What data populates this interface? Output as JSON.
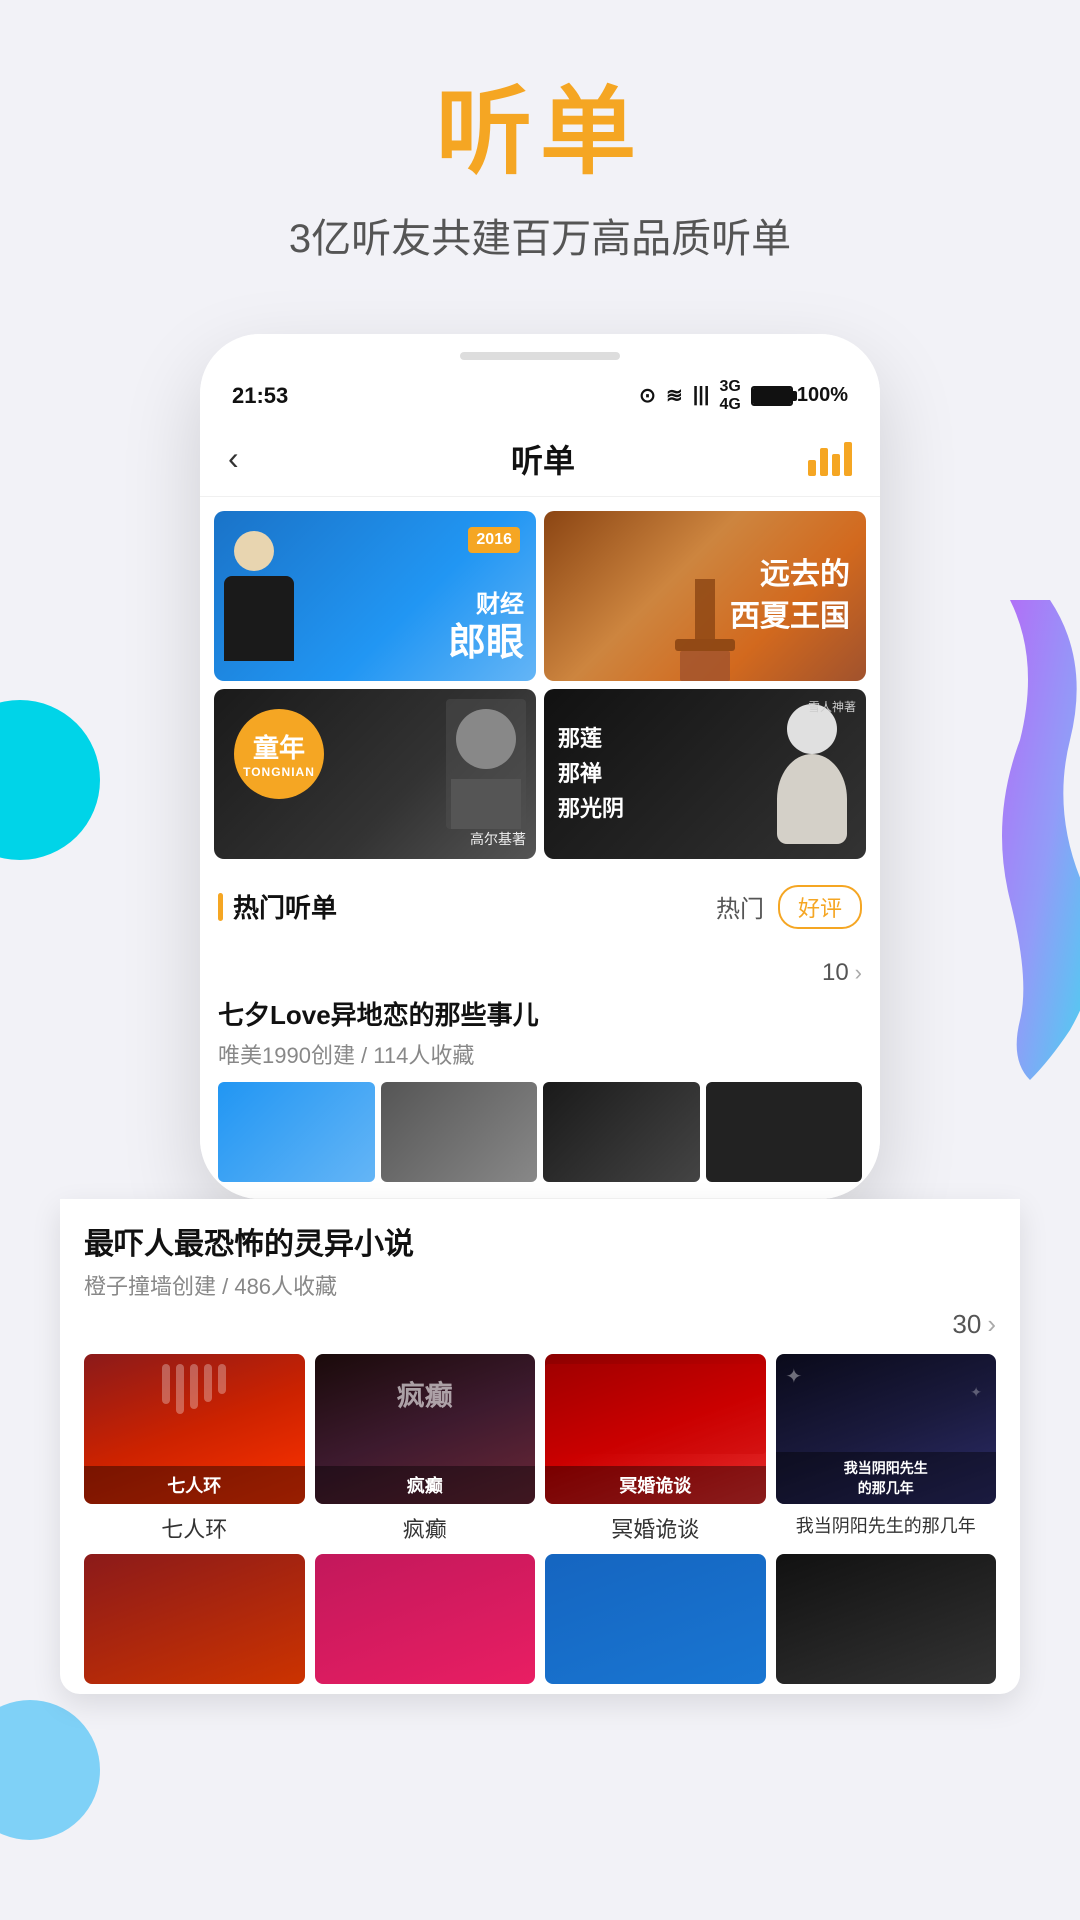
{
  "page": {
    "background_color": "#f2f2f7"
  },
  "header": {
    "title": "听单",
    "subtitle": "3亿听友共建百万高品质听单",
    "title_color": "#f5a623"
  },
  "status_bar": {
    "time": "21:53",
    "battery": "100%",
    "signal_icons": "⊙ ≋ |||"
  },
  "app_navbar": {
    "back_label": "‹",
    "title": "听单",
    "chart_icon_label": "chart-icon"
  },
  "banners": [
    {
      "id": "banner1",
      "type": "blue-man",
      "year": "2016",
      "title_line1": "财经",
      "title_line2": "郎眼",
      "style": "blue"
    },
    {
      "id": "banner2",
      "title_line1": "远去的",
      "title_line2": "西夏王国",
      "style": "desert"
    },
    {
      "id": "banner3",
      "circle_title": "童年",
      "circle_sub": "TONGNIAN",
      "author": "高尔基著",
      "style": "dark-child"
    },
    {
      "id": "banner4",
      "line1": "那莲",
      "line2": "那禅",
      "line3": "那光阴",
      "subtitle": "雪人神著",
      "style": "dark-woman"
    }
  ],
  "section": {
    "title": "热门听单",
    "filter1": "热门",
    "filter2": "好评"
  },
  "playlists": [
    {
      "title": "七夕Love异地恋的那些事儿",
      "meta": "唯美1990创建 / 114人收藏",
      "count": "10"
    },
    {
      "title": "最吓人最恐怖的灵异小说",
      "meta": "橙子撞墙创建 / 486人收藏",
      "count": "30"
    }
  ],
  "books": [
    {
      "title": "七人环",
      "name": "七人环",
      "style": "book-red"
    },
    {
      "title": "疯癫",
      "name": "疯癫",
      "style": "book-dark-drama"
    },
    {
      "title": "冥婚诡谈",
      "name": "冥婚诡谈",
      "style": "book-red-veil"
    },
    {
      "title": "我当阴阳先生的那几年",
      "name": "我当阴阳先生的那几年",
      "style": "book-dark-night"
    }
  ],
  "icons": {
    "back": "‹",
    "chevron_right": "›"
  }
}
